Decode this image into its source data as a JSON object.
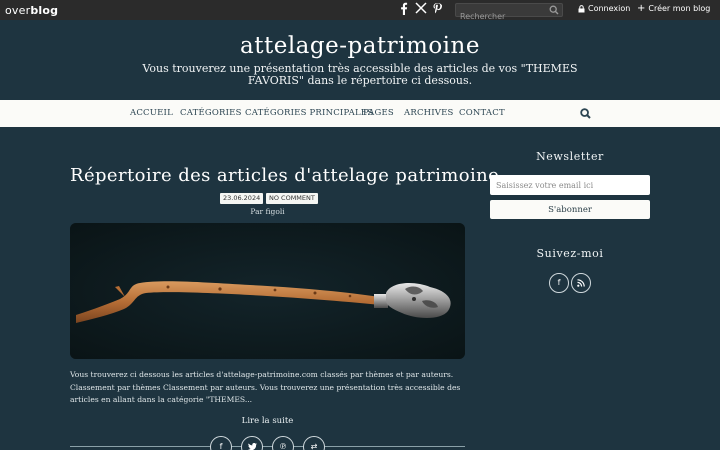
{
  "topbar": {
    "logo_part1": "over",
    "logo_part2": "blog",
    "social": [
      "facebook-icon",
      "x-icon",
      "pinterest-icon"
    ],
    "search_placeholder": "Rechercher",
    "login_label": "Connexion",
    "create_label": "Créer mon blog"
  },
  "header": {
    "title": "attelage-patrimoine",
    "description": "Vous trouverez une présentation très accessible des articles de vos \"THEMES FAVORIS\" dans le répertoire ci dessous."
  },
  "nav": {
    "items": [
      "ACCUEIL",
      "CATÉGORIES",
      "CATÉGORIES PRINCIPALES",
      "PAGES",
      "ARCHIVES",
      "CONTACT"
    ]
  },
  "article": {
    "title": "Répertoire des articles d'attelage patrimoine.",
    "date": "23.06.2024",
    "comments": "NO COMMENT",
    "byline": "Par figoli",
    "excerpt": "Vous trouverez ci dessous les articles d'attelage-patrimoine.com classés par thèmes et par auteurs. Classement par thèmes Classement par auteurs. Vous trouverez une présentation très accessible des articles en allant dans la catégorie \"THEMES...",
    "read_more": "Lire la suite",
    "share_icons": [
      "facebook-icon",
      "twitter-icon",
      "pinterest-icon",
      "share-icon"
    ]
  },
  "sidebar": {
    "newsletter_title": "Newsletter",
    "email_placeholder": "Saisissez votre email ici",
    "subscribe_label": "S'abonner",
    "follow_title": "Suivez-moi",
    "follow_icons": [
      "facebook-icon",
      "rss-icon"
    ]
  },
  "colors": {
    "background": "#1e3440",
    "topbar": "#2b2b2b",
    "nav_background": "#fbfbf8",
    "nav_text": "#2c4552"
  }
}
